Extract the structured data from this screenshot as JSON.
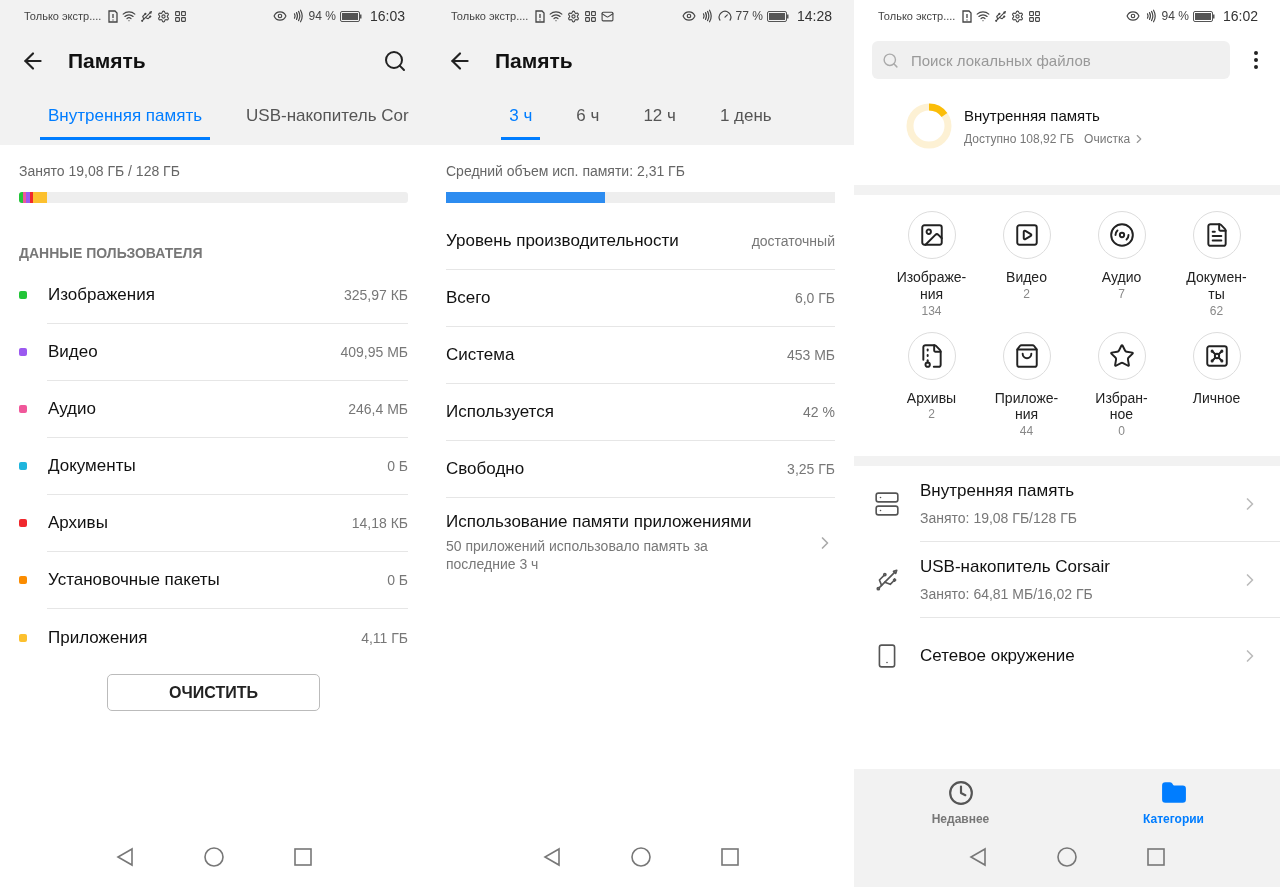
{
  "panels": [
    {
      "kind": "storage",
      "status_bar": {
        "carrier": "Только экстр....",
        "left_icons": [
          {
            "kind": "sim"
          },
          {
            "kind": "wifi"
          },
          {
            "kind": "usb"
          },
          {
            "kind": "gear"
          },
          {
            "kind": "grid"
          }
        ],
        "right_icons": [
          {
            "kind": "eye"
          },
          {
            "kind": "nfc"
          }
        ],
        "battery": "94 %",
        "time": "16:03"
      },
      "header": {
        "title": "Память",
        "search": true
      },
      "tabs": [
        {
          "label": "Внутренняя память",
          "selected": true
        },
        {
          "label": "USB-накопитель Cor",
          "selected": false
        }
      ],
      "usage": {
        "label": "Занято 19,08 ГБ / 128 ГБ",
        "segments": [
          {
            "color": "#22c538",
            "level": 0.009
          },
          {
            "color": "#f0579a",
            "level": 0.009
          },
          {
            "color": "#9b59f0",
            "level": 0.009
          },
          {
            "color": "#f0282d",
            "level": 0.009
          },
          {
            "color": "#fcc02e",
            "level": 0.036
          }
        ]
      },
      "section_title": "ДАННЫЕ ПОЛЬЗОВАТЕЛЯ",
      "items": [
        {
          "name": "Изображения",
          "size": "325,97 КБ",
          "color": "#22c538"
        },
        {
          "name": "Видео",
          "size": "409,95 МБ",
          "color": "#9b59f0"
        },
        {
          "name": "Аудио",
          "size": "246,4 МБ",
          "color": "#f0579a"
        },
        {
          "name": "Документы",
          "size": "0 Б",
          "color": "#1fb5dd"
        },
        {
          "name": "Архивы",
          "size": "14,18 КБ",
          "color": "#f0282d"
        },
        {
          "name": "Установочные пакеты",
          "size": "0 Б",
          "color": "#fb8c00"
        },
        {
          "name": "Приложения",
          "size": "4,11 ГБ",
          "color": "#fcc02e"
        }
      ],
      "button": "ОЧИСТИТЬ"
    },
    {
      "kind": "memory",
      "status_bar": {
        "carrier": "Только экстр....",
        "left_icons": [
          {
            "kind": "sim"
          },
          {
            "kind": "wifi"
          },
          {
            "kind": "gear"
          },
          {
            "kind": "grid"
          },
          {
            "kind": "mail"
          }
        ],
        "right_icons": [
          {
            "kind": "eye"
          },
          {
            "kind": "nfc"
          },
          {
            "kind": "gauge"
          }
        ],
        "battery": "77 %",
        "time": "14:28"
      },
      "header": {
        "title": "Память",
        "search": false
      },
      "tabs": [
        {
          "label": "3 ч",
          "selected": true
        },
        {
          "label": "6 ч",
          "selected": false
        },
        {
          "label": "12 ч",
          "selected": false
        },
        {
          "label": "1 день",
          "selected": false
        }
      ],
      "usage": {
        "label": "Средний объем исп. памяти: 2,31 ГБ",
        "level": 0.41
      },
      "rows": [
        {
          "label": "Уровень производительности",
          "value": "достаточный"
        },
        {
          "label": "Всего",
          "value": "6,0 ГБ"
        },
        {
          "label": "Система",
          "value": "453 МБ"
        },
        {
          "label": "Используется",
          "value": "42 %"
        },
        {
          "label": "Свободно",
          "value": "3,25 ГБ"
        }
      ],
      "link": {
        "title": "Использование памяти приложениями",
        "subtitle": "50 приложений использовало память за последние 3 ч"
      }
    },
    {
      "kind": "files",
      "status_bar": {
        "carrier": "Только экстр....",
        "left_icons": [
          {
            "kind": "sim"
          },
          {
            "kind": "wifi"
          },
          {
            "kind": "usb"
          },
          {
            "kind": "gear"
          },
          {
            "kind": "grid"
          }
        ],
        "right_icons": [
          {
            "kind": "eye"
          },
          {
            "kind": "nfc"
          }
        ],
        "battery": "94 %",
        "time": "16:02"
      },
      "search": {
        "placeholder": "Поиск локальных файлов"
      },
      "storage": {
        "title": "Внутренняя память",
        "available": "Доступно 108,92 ГБ",
        "action": "Очистка",
        "level": 0.15
      },
      "categories": [
        {
          "kind": "image",
          "label": "Изображе-\nния",
          "count": "134"
        },
        {
          "kind": "video",
          "label": "Видео",
          "count": "2"
        },
        {
          "kind": "audio",
          "label": "Аудио",
          "count": "7"
        },
        {
          "kind": "document",
          "label": "Докумен-\nты",
          "count": "62"
        },
        {
          "kind": "archive",
          "label": "Архивы",
          "count": "2"
        },
        {
          "kind": "app",
          "label": "Приложе-\nния",
          "count": "44"
        },
        {
          "kind": "favorite",
          "label": "Избран-\nное",
          "count": "0"
        },
        {
          "kind": "safe",
          "label": "Личное"
        }
      ],
      "locations": [
        {
          "kind": "internal",
          "title": "Внутренняя память",
          "subtitle": "Занято: 19,08 ГБ/128 ГБ"
        },
        {
          "kind": "usb",
          "title": "USB-накопитель Corsair",
          "subtitle": "Занято: 64,81 МБ/16,02 ГБ"
        },
        {
          "kind": "network",
          "title": "Сетевое окружение"
        }
      ],
      "bottom_tabs": [
        {
          "kind": "recent",
          "label": "Недавнее",
          "selected": false
        },
        {
          "kind": "categories",
          "label": "Категории",
          "selected": true
        }
      ]
    }
  ]
}
